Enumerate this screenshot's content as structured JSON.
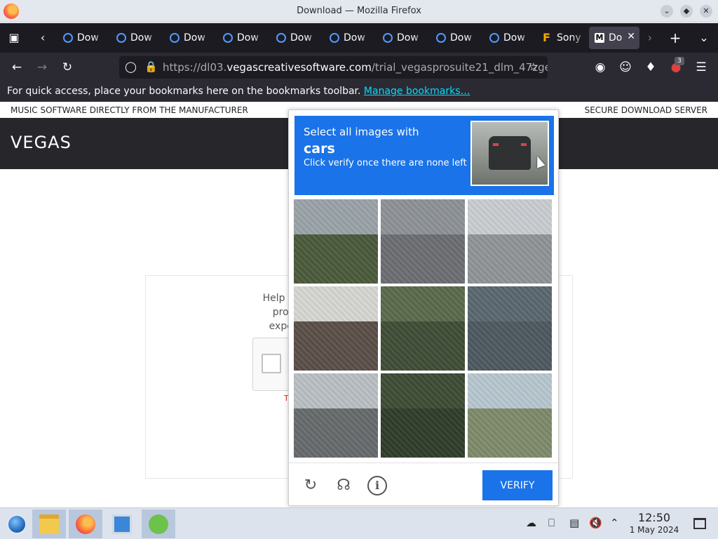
{
  "window": {
    "title": "Download — Mozilla Firefox",
    "controls": [
      "minimize",
      "maximize",
      "close"
    ]
  },
  "tabs": [
    {
      "label": "Dow",
      "favicon": "loading-icon",
      "active": false
    },
    {
      "label": "Dow",
      "favicon": "loading-icon",
      "active": false
    },
    {
      "label": "Dow",
      "favicon": "loading-icon",
      "active": false
    },
    {
      "label": "Dow",
      "favicon": "loading-icon",
      "active": false
    },
    {
      "label": "Dow",
      "favicon": "loading-icon",
      "active": false
    },
    {
      "label": "Dow",
      "favicon": "loading-icon",
      "active": false
    },
    {
      "label": "Dow",
      "favicon": "loading-icon",
      "active": false
    },
    {
      "label": "Dow",
      "favicon": "loading-icon",
      "active": false
    },
    {
      "label": "Dow",
      "favicon": "loading-icon",
      "active": false
    },
    {
      "label": "Sony",
      "favicon": "F",
      "active": false
    },
    {
      "label": "Do",
      "favicon": "M",
      "active": true
    }
  ],
  "navbar": {
    "url_prefix": "https://dl03.",
    "url_host": "vegascreativesoftware.com",
    "url_path": "/trial_vegasprosuite21_dlm_47zge",
    "extension_badge": "3"
  },
  "bookmarks": {
    "message": "For quick access, place your bookmarks here on the bookmarks toolbar.",
    "link": "Manage bookmarks…"
  },
  "page": {
    "topstrip_left": "MUSIC SOFTWARE DIRECTLY FROM THE MANUFACTURER",
    "topstrip_right": "SECURE DOWNLOAD SERVER",
    "logo": "VEGAS",
    "help_lines": [
      "Help us preve",
      "prompted",
      "experiencir"
    ],
    "partial_red": "T"
  },
  "challenge": {
    "line1": "Select all images with",
    "line2": "cars",
    "line3": "Click verify once there are none left",
    "verify_label": "VERIFY",
    "tiles": [
      {
        "sky": "#9aa3a8",
        "ground": "#4a5a3a"
      },
      {
        "sky": "#8d9297",
        "ground": "#6b6e72"
      },
      {
        "sky": "#c9cdd1",
        "ground": "#8f9496"
      },
      {
        "sky": "#d6d6d2",
        "ground": "#5a4f48"
      },
      {
        "sky": "#5a6a4c",
        "ground": "#3f4d36"
      },
      {
        "sky": "#5b6770",
        "ground": "#4d5860"
      },
      {
        "sky": "#b9bfc4",
        "ground": "#666a6c"
      },
      {
        "sky": "#3e4c35",
        "ground": "#2f3d2a"
      },
      {
        "sky": "#b7c6cf",
        "ground": "#7e8a6a"
      }
    ]
  },
  "taskbar": {
    "time": "12:50",
    "date": "1 May 2024"
  },
  "colors": {
    "accent": "#1a73e8",
    "browser_dark": "#1c1b22",
    "toolbar": "#2b2a33",
    "site_header": "#27272b"
  }
}
